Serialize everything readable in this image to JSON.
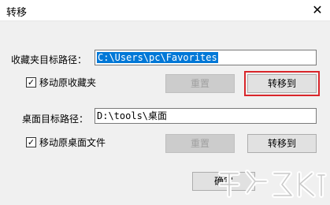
{
  "window": {
    "title": "转移",
    "close_glyph": "✕"
  },
  "favorites": {
    "path_label": "收藏夹目标路径：",
    "path_value": "C:\\Users\\pc\\Favorites",
    "move_checkbox_label": "移动原收藏夹",
    "move_checked": true,
    "reset_label": "重置",
    "transfer_label": "转移到"
  },
  "desktop": {
    "path_label": "桌面目标路径：",
    "path_value": "D:\\tools\\桌面",
    "move_checkbox_label": "移动原桌面文件",
    "move_checked": true,
    "reset_label": "重置",
    "transfer_label": "转移到"
  },
  "footer": {
    "ok_label": "确定"
  },
  "colors": {
    "selection": "#0078d7",
    "highlight_border": "#d9262b"
  }
}
